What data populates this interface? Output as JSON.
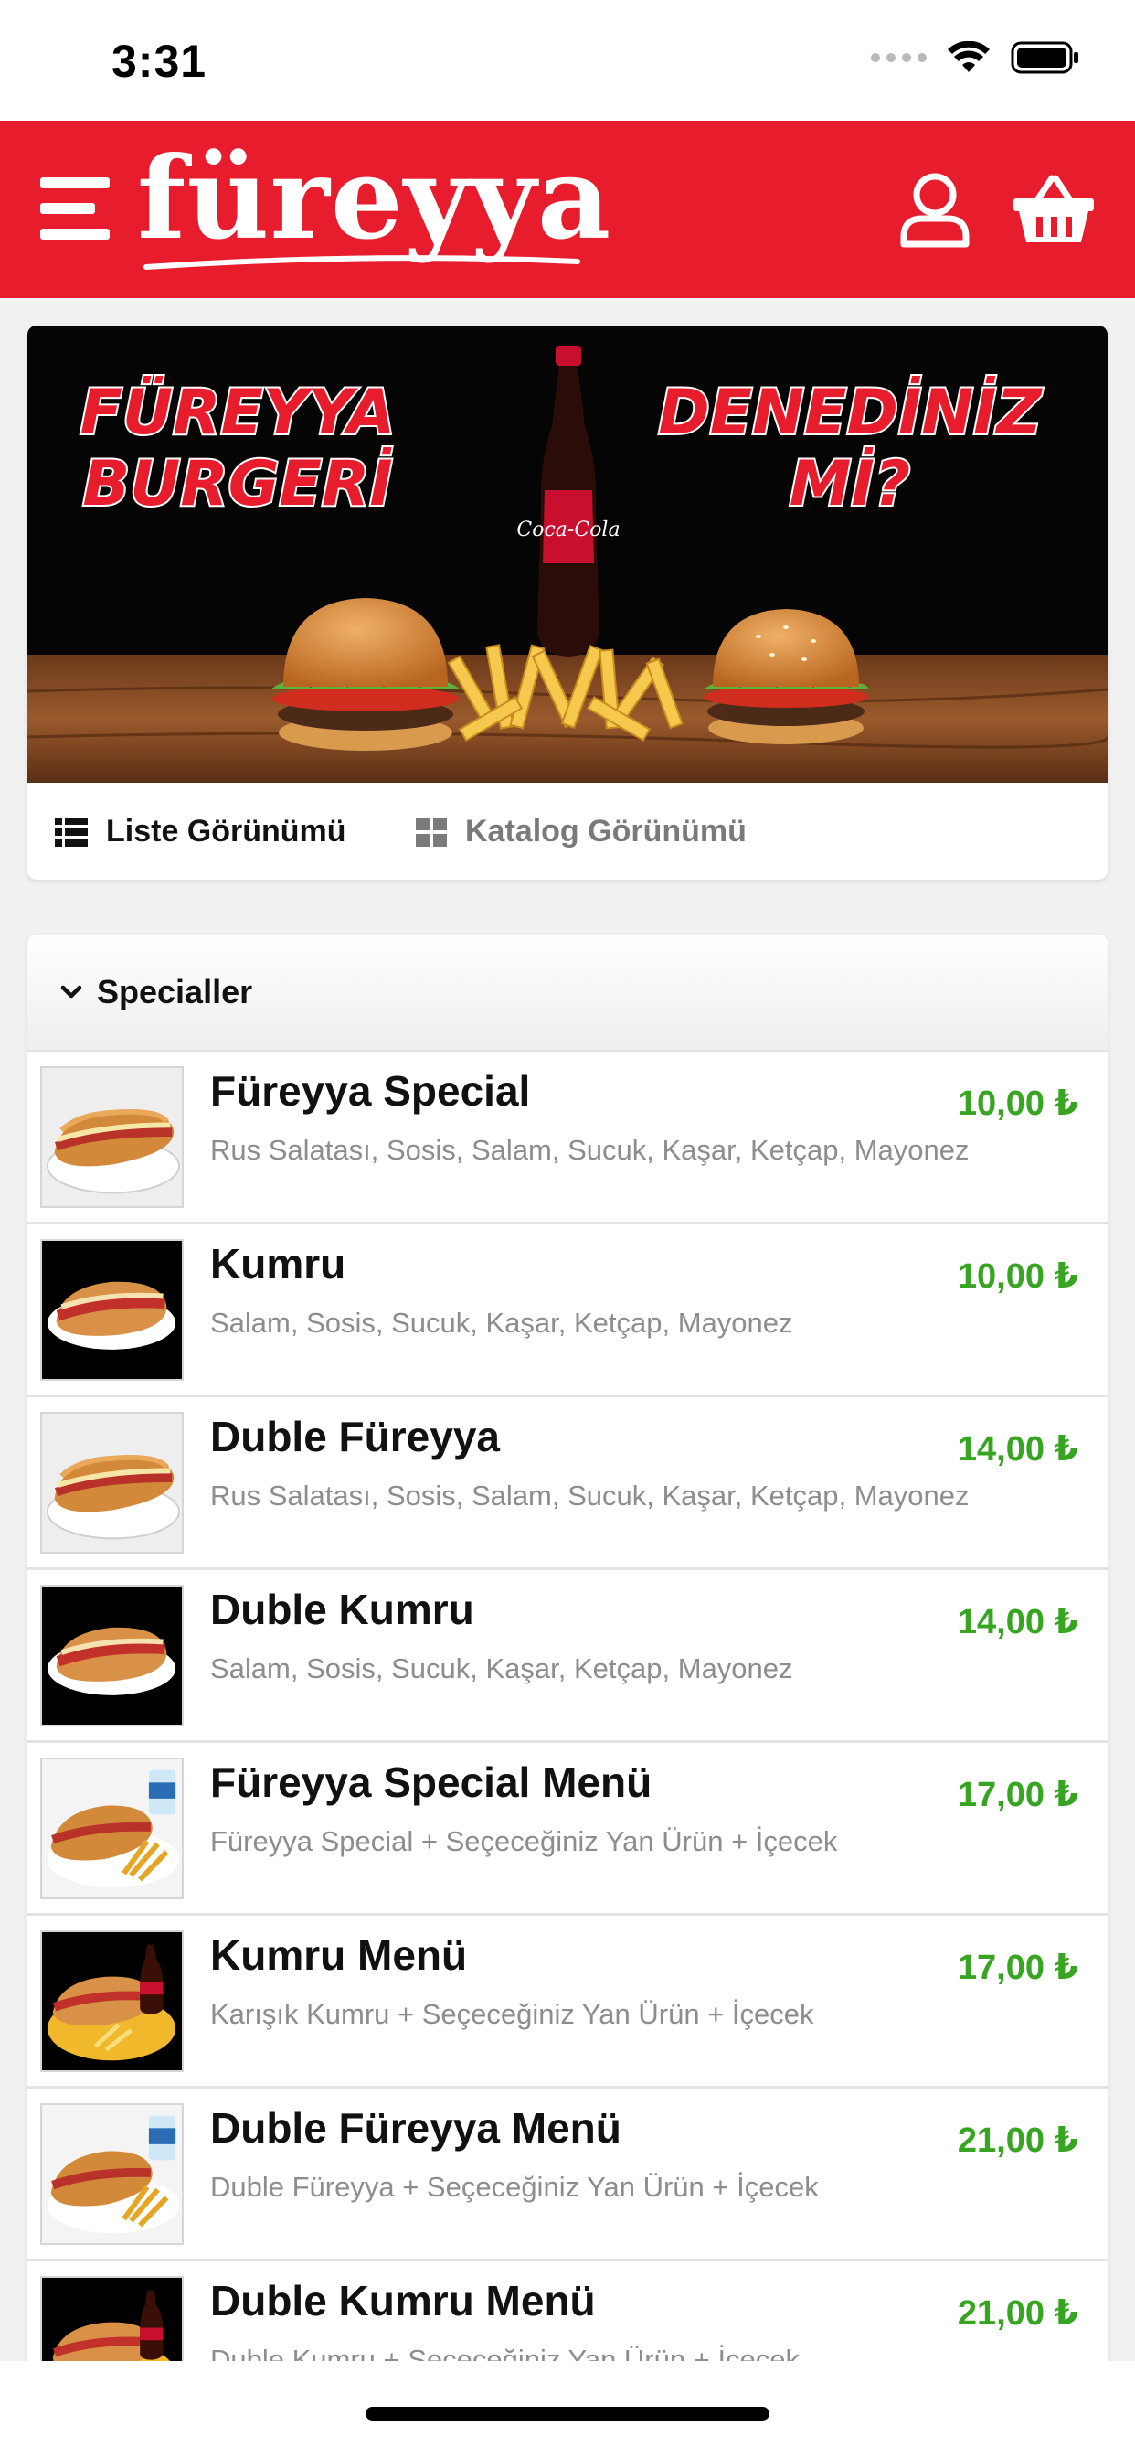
{
  "status_bar": {
    "time": "3:31"
  },
  "header": {
    "logo_text": "füreyya",
    "brand_color": "#e71c2d",
    "menu_icon": "hamburger-menu-icon",
    "user_icon": "user-icon",
    "cart_icon": "shopping-basket-icon"
  },
  "banner": {
    "headline_left_1": "FÜREYYA",
    "headline_left_2": "BURGERİ",
    "headline_right_1": "DENEDİNİZ",
    "headline_right_2": "Mİ?",
    "bottle_label": "Coca-Cola"
  },
  "view_toggle": {
    "list_label": "Liste Görünümü",
    "catalog_label": "Katalog Görünümü"
  },
  "category": {
    "title": "Specialler"
  },
  "products": [
    {
      "name": "Füreyya Special",
      "desc": "Rus Salatası, Sosis, Salam, Sucuk, Kaşar, Ketçap, Mayonez",
      "price": "10,00 ₺",
      "thumb": "sandwich"
    },
    {
      "name": "Kumru",
      "desc": "Salam, Sosis, Sucuk, Kaşar, Ketçap, Mayonez",
      "price": "10,00 ₺",
      "thumb": "kumru"
    },
    {
      "name": "Duble Füreyya",
      "desc": "Rus Salatası, Sosis, Salam, Sucuk, Kaşar, Ketçap, Mayonez",
      "price": "14,00 ₺",
      "thumb": "sandwich"
    },
    {
      "name": "Duble Kumru",
      "desc": "Salam, Sosis, Sucuk, Kaşar, Ketçap, Mayonez",
      "price": "14,00 ₺",
      "thumb": "kumru"
    },
    {
      "name": "Füreyya Special Menü",
      "desc": "Füreyya Special + Seçeceğiniz Yan Ürün + İçecek",
      "price": "17,00 ₺",
      "thumb": "menu"
    },
    {
      "name": "Kumru Menü",
      "desc": "Karışık Kumru + Seçeceğiniz Yan Ürün + İçecek",
      "price": "17,00 ₺",
      "thumb": "kumru-menu"
    },
    {
      "name": "Duble Füreyya Menü",
      "desc": "Duble Füreyya + Seçeceğiniz Yan Ürün + İçecek",
      "price": "21,00 ₺",
      "thumb": "menu"
    },
    {
      "name": "Duble Kumru Menü",
      "desc": "Duble Kumru + Seçeceğiniz Yan Ürün + İçecek",
      "price": "21,00 ₺",
      "thumb": "kumru-menu"
    }
  ],
  "colors": {
    "price": "#37a522",
    "description": "#8d8d8d"
  }
}
